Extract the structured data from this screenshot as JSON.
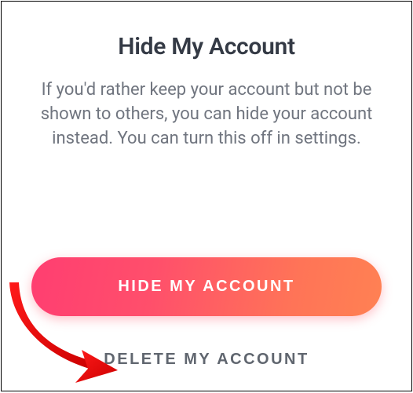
{
  "modal": {
    "title": "Hide My Account",
    "description": "If you'd rather keep your account but not be shown to others, you can hide your account instead. You can turn this off in settings."
  },
  "actions": {
    "hide_button_label": "HIDE MY ACCOUNT",
    "delete_link_label": "DELETE MY ACCOUNT"
  }
}
